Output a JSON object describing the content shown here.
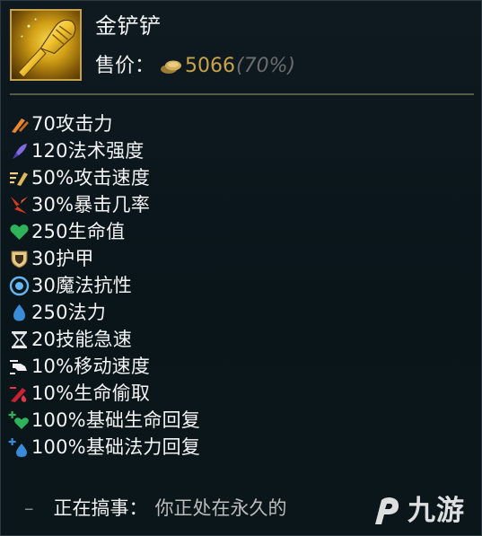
{
  "item": {
    "name": "金铲铲",
    "price_label": "售价：",
    "price_value": "5066",
    "sell_ratio": "(70%)"
  },
  "stats": [
    {
      "icon": "attack-damage-icon",
      "text": "70攻击力"
    },
    {
      "icon": "ability-power-icon",
      "text": "120法术强度"
    },
    {
      "icon": "attack-speed-icon",
      "text": "50%攻击速度"
    },
    {
      "icon": "critical-strike-icon",
      "text": "30%暴击几率"
    },
    {
      "icon": "health-icon",
      "text": "250生命值"
    },
    {
      "icon": "armor-icon",
      "text": "30护甲"
    },
    {
      "icon": "magic-resist-icon",
      "text": "30魔法抗性"
    },
    {
      "icon": "mana-icon",
      "text": "250法力"
    },
    {
      "icon": "ability-haste-icon",
      "text": "20技能急速"
    },
    {
      "icon": "move-speed-icon",
      "text": "10%移动速度"
    },
    {
      "icon": "life-steal-icon",
      "text": "10%生命偷取"
    },
    {
      "icon": "health-regen-icon",
      "text": "100%基础生命回复"
    },
    {
      "icon": "mana-regen-icon",
      "text": "100%基础法力回复"
    }
  ],
  "passive": {
    "dash": "–",
    "name": "正在搞事：",
    "description": "你正处在永久的"
  },
  "watermark": {
    "text": "九游",
    "logo": "jiuyou-logo-icon"
  },
  "colors": {
    "gold": "#c9a24a",
    "divider": "#5b5a45",
    "text": "#f4f4f4",
    "muted": "#6c6c6c",
    "health_green": "#2fb35a",
    "mana_blue": "#3a8bd8"
  }
}
